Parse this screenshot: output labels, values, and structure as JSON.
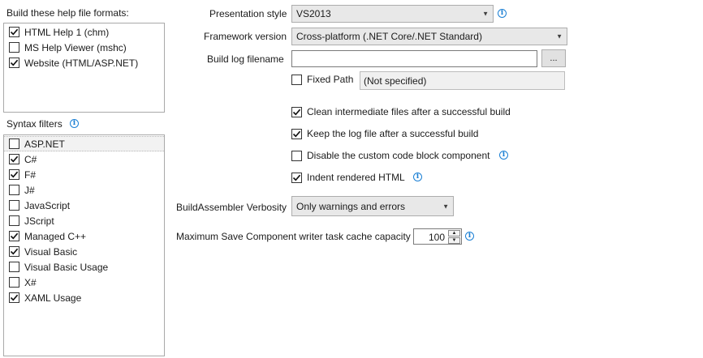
{
  "formats": {
    "label": "Build these help file formats:",
    "items": [
      {
        "label": "HTML Help 1 (chm)",
        "checked": true
      },
      {
        "label": "MS Help Viewer (mshc)",
        "checked": false
      },
      {
        "label": "Website (HTML/ASP.NET)",
        "checked": true
      }
    ]
  },
  "syntax": {
    "label": "Syntax filters",
    "items": [
      {
        "label": "ASP.NET",
        "checked": false
      },
      {
        "label": "C#",
        "checked": true
      },
      {
        "label": "F#",
        "checked": true
      },
      {
        "label": "J#",
        "checked": false
      },
      {
        "label": "JavaScript",
        "checked": false
      },
      {
        "label": "JScript",
        "checked": false
      },
      {
        "label": "Managed C++",
        "checked": true
      },
      {
        "label": "Visual Basic",
        "checked": true
      },
      {
        "label": "Visual Basic Usage",
        "checked": false
      },
      {
        "label": "X#",
        "checked": false
      },
      {
        "label": "XAML Usage",
        "checked": true
      }
    ]
  },
  "presentation": {
    "label": "Presentation style",
    "value": "VS2013"
  },
  "framework": {
    "label": "Framework version",
    "value": "Cross-platform (.NET Core/.NET Standard)"
  },
  "buildlog": {
    "label": "Build log filename",
    "value": "",
    "browse_label": "..."
  },
  "fixedpath": {
    "label": "Fixed Path",
    "checked": false,
    "value": "(Not specified)"
  },
  "options": [
    {
      "label": "Clean intermediate files after a successful build",
      "checked": true
    },
    {
      "label": "Keep the log file after a successful build",
      "checked": true
    },
    {
      "label": "Disable the custom code block component",
      "checked": false
    },
    {
      "label": "Indent rendered HTML",
      "checked": true
    }
  ],
  "verbosity": {
    "label": "BuildAssembler Verbosity",
    "value": "Only warnings and errors"
  },
  "cache": {
    "label": "Maximum Save Component writer task cache capacity",
    "value": "100"
  },
  "colors": {
    "accent": "#1a7fd4",
    "border": "#a9a9a9"
  }
}
